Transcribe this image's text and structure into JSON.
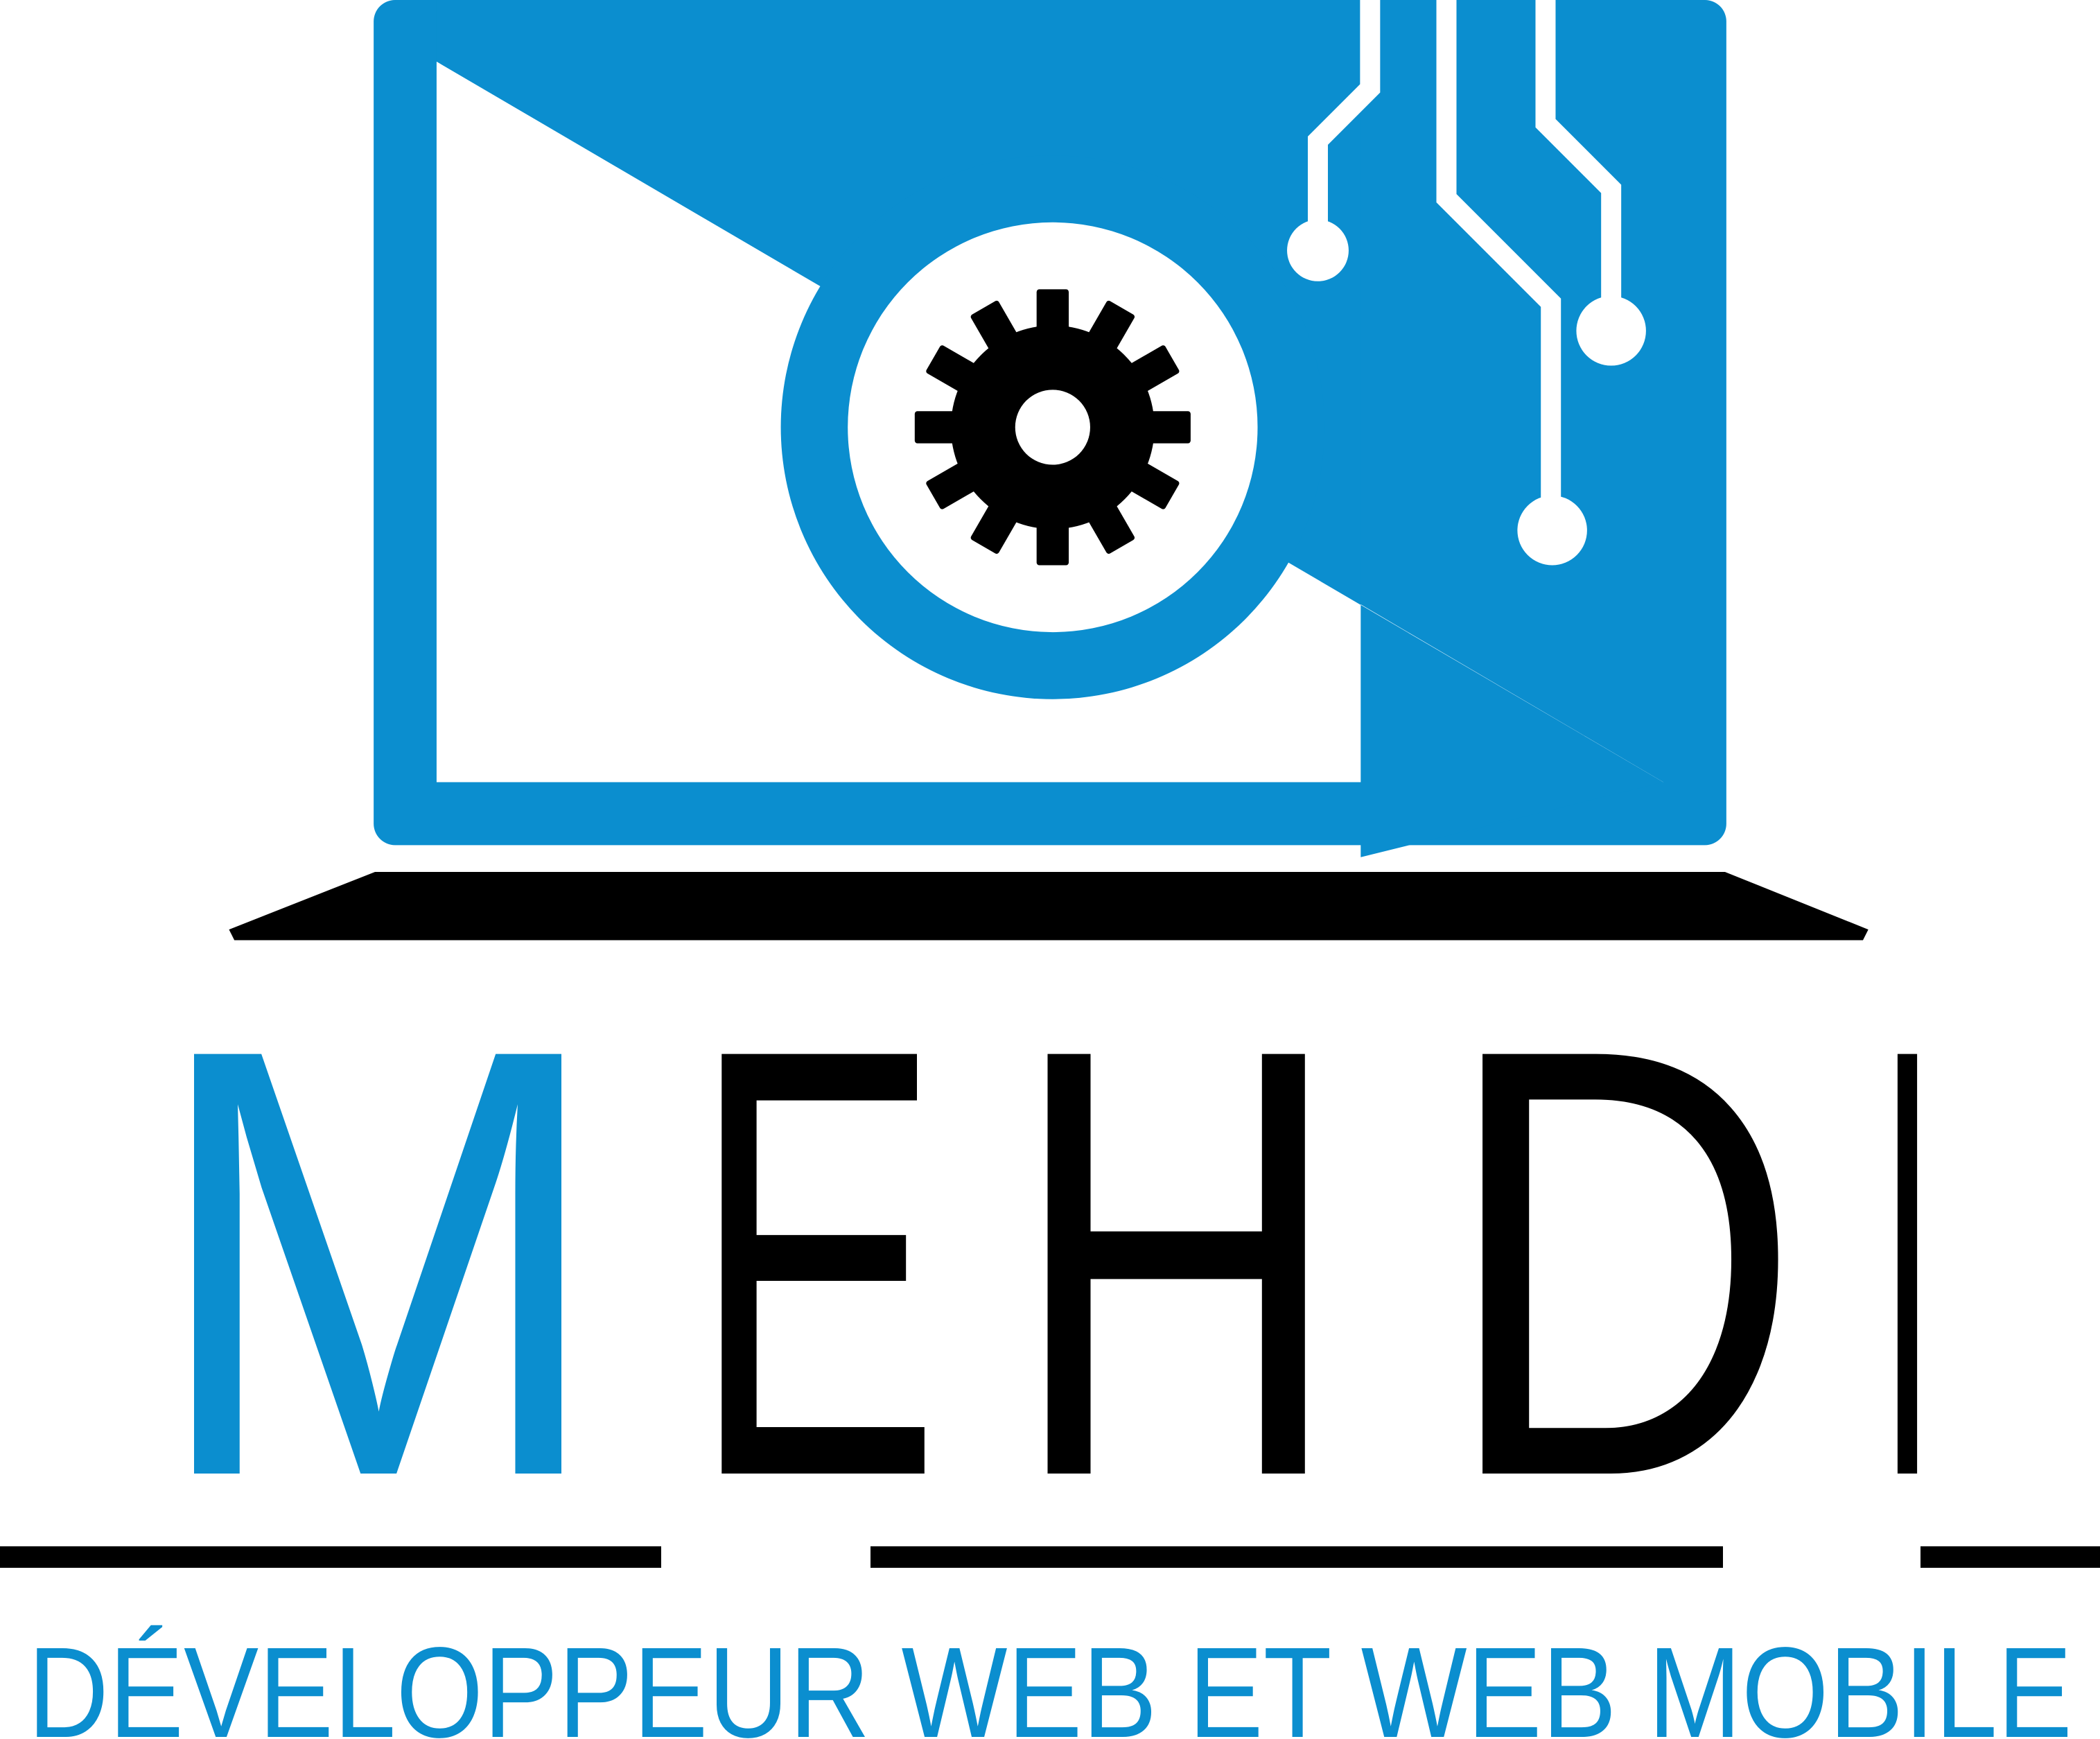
{
  "logo": {
    "brand_name": "MEHDI",
    "brand_letters": [
      "M",
      "E",
      "H",
      "D",
      "I"
    ],
    "tagline": "DÉVELOPPEUR WEB ET WEB MOBILE"
  },
  "icons": {
    "laptop": "laptop-icon",
    "gear": "gear-icon",
    "circuit": "circuit-traces-icon"
  },
  "colors": {
    "brand_blue": "#0b8ecf",
    "black": "#000000",
    "white": "#ffffff"
  }
}
